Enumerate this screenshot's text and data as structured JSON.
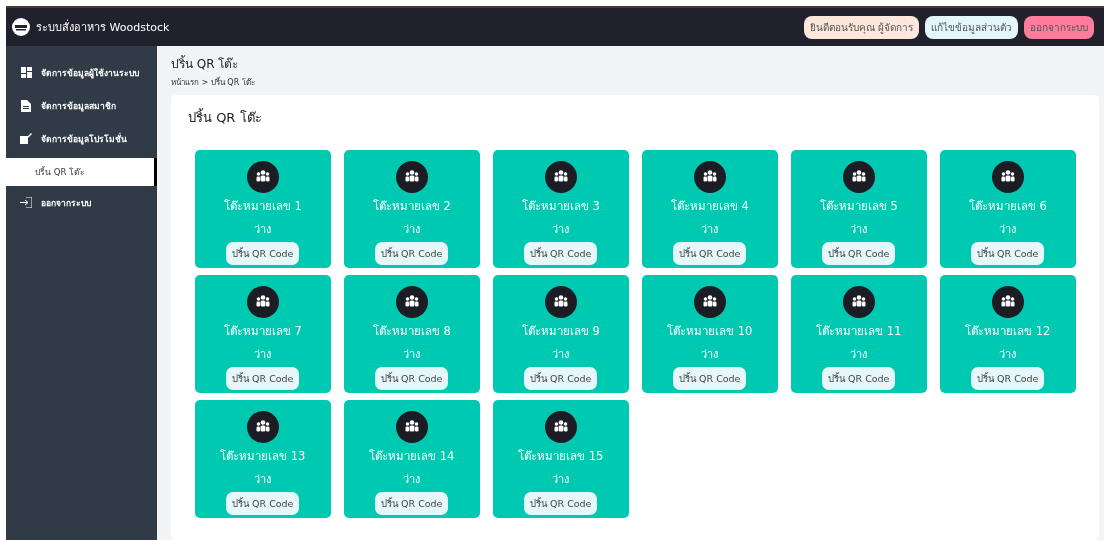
{
  "header": {
    "title": "ระบบสั่งอาหาร Woodstock",
    "buttons": [
      {
        "label": "ยินดีตอนรับคุณ ผู้จัดการ",
        "color": "#fde6dc"
      },
      {
        "label": "แก้ไขข้อมูลส่วนตัว",
        "color": "#e2f6fb"
      },
      {
        "label": "ออกจากระบบ",
        "color": "#ff7c9c"
      }
    ]
  },
  "sidebar": {
    "items": [
      {
        "label": "จัดการข้อมูลผู้ใช้งานระบบ",
        "selected": false
      },
      {
        "label": "จัดการข้อมูลสมาชิก",
        "selected": false
      },
      {
        "label": "จัดการข้อมูลโปรโมชั่น",
        "selected": false,
        "children": [
          {
            "label": "ปริ้น QR โต๊ะ",
            "selected": true
          }
        ]
      },
      {
        "label": "ออกจากระบบ",
        "selected": false
      }
    ]
  },
  "page": {
    "title": "ปริ้น QR โต๊ะ",
    "breadcrumb": "หน้าแรก > ปริ้น QR โต๊ะ"
  },
  "card": {
    "title": "ปริ้น QR โต๊ะ",
    "tables": [
      {
        "name": "โต๊ะหมายเลข 1",
        "status": "ว่าง",
        "button": "ปริ้น QR Code"
      },
      {
        "name": "โต๊ะหมายเลข 2",
        "status": "ว่าง",
        "button": "ปริ้น QR Code"
      },
      {
        "name": "โต๊ะหมายเลข 3",
        "status": "ว่าง",
        "button": "ปริ้น QR Code"
      },
      {
        "name": "โต๊ะหมายเลข 4",
        "status": "ว่าง",
        "button": "ปริ้น QR Code"
      },
      {
        "name": "โต๊ะหมายเลข 5",
        "status": "ว่าง",
        "button": "ปริ้น QR Code"
      },
      {
        "name": "โต๊ะหมายเลข 6",
        "status": "ว่าง",
        "button": "ปริ้น QR Code"
      },
      {
        "name": "โต๊ะหมายเลข 7",
        "status": "ว่าง",
        "button": "ปริ้น QR Code"
      },
      {
        "name": "โต๊ะหมายเลข 8",
        "status": "ว่าง",
        "button": "ปริ้น QR Code"
      },
      {
        "name": "โต๊ะหมายเลข 9",
        "status": "ว่าง",
        "button": "ปริ้น QR Code"
      },
      {
        "name": "โต๊ะหมายเลข 10",
        "status": "ว่าง",
        "button": "ปริ้น QR Code"
      },
      {
        "name": "โต๊ะหมายเลข 11",
        "status": "ว่าง",
        "button": "ปริ้น QR Code"
      },
      {
        "name": "โต๊ะหมายเลข 12",
        "status": "ว่าง",
        "button": "ปริ้น QR Code"
      },
      {
        "name": "โต๊ะหมายเลข 13",
        "status": "ว่าง",
        "button": "ปริ้น QR Code"
      },
      {
        "name": "โต๊ะหมายเลข 14",
        "status": "ว่าง",
        "button": "ปริ้น QR Code"
      },
      {
        "name": "โต๊ะหมายเลข 15",
        "status": "ว่าง",
        "button": "ปริ้น QR Code"
      }
    ]
  }
}
